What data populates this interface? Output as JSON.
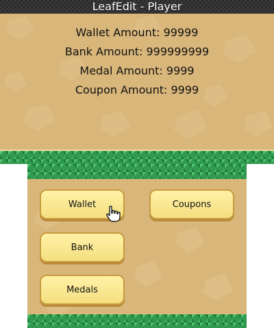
{
  "window": {
    "title": "LeafEdit - Player"
  },
  "player": {
    "wallet_line": "Wallet Amount: 99999",
    "bank_line": "Bank Amount: 999999999",
    "medal_line": "Medal Amount: 9999",
    "coupon_line": "Coupon Amount: 9999"
  },
  "buttons": {
    "wallet": "Wallet",
    "coupons": "Coupons",
    "bank": "Bank",
    "medals": "Medals"
  },
  "icons": {
    "cursor": "hand-pointer-icon"
  },
  "colors": {
    "sand": "#d9b67a",
    "grass": "#2f9a50",
    "button": "#f4df80",
    "button_border": "#c79a3d"
  }
}
